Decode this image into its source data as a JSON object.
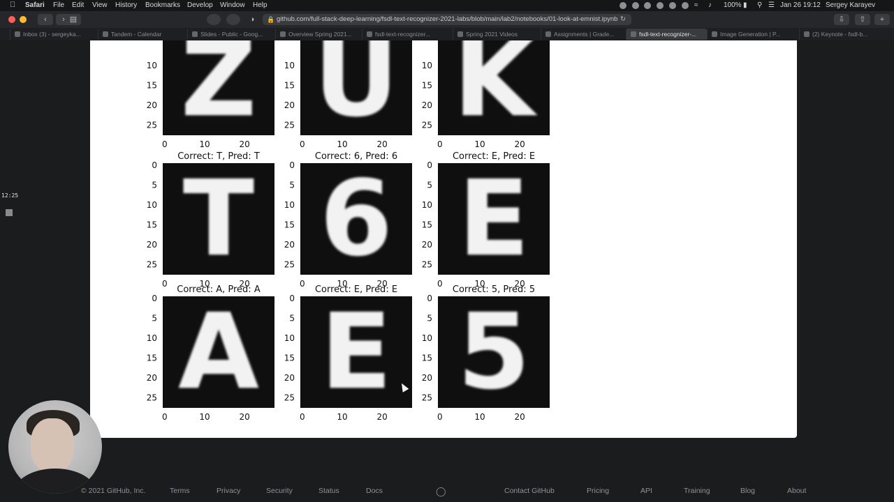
{
  "menubar": {
    "app_name": "Safari",
    "items": [
      "File",
      "Edit",
      "View",
      "History",
      "Bookmarks",
      "Develop",
      "Window",
      "Help"
    ],
    "battery": "100%",
    "datetime": "Jan 26  19:12",
    "user": "Sergey Karayev"
  },
  "toolbar": {
    "url": "github.com/full-stack-deep-learning/fsdl-text-recognizer-2021-labs/blob/main/lab2/notebooks/01-look-at-emnist.ipynb"
  },
  "tabs": [
    {
      "label": "Inbox (3) - sergeyka..."
    },
    {
      "label": "Tandem - Calendar"
    },
    {
      "label": "Slides - Public - Goog..."
    },
    {
      "label": "Overview Spring 2021..."
    },
    {
      "label": "fsdl-text-recognizer..."
    },
    {
      "label": "Spring 2021 Videos"
    },
    {
      "label": "Assignments | Grade..."
    },
    {
      "label": "fsdl-text-recognizer-...",
      "active": true
    },
    {
      "label": "Image Generation | P..."
    },
    {
      "label": "(2) Keynote - fsdl-b..."
    }
  ],
  "side_widget": {
    "time": "12:25"
  },
  "figure": {
    "panels": [
      {
        "title": "",
        "char": "Z"
      },
      {
        "title": "",
        "char": "U"
      },
      {
        "title": "",
        "char": "K"
      },
      {
        "title": "Correct: T, Pred: T",
        "char": "T"
      },
      {
        "title": "Correct: 6, Pred: 6",
        "char": "6"
      },
      {
        "title": "Correct: E, Pred: E",
        "char": "E"
      },
      {
        "title": "Correct: A, Pred: A",
        "char": "A"
      },
      {
        "title": "Correct: E, Pred: E",
        "char": "E"
      },
      {
        "title": "Correct: 5, Pred: 5",
        "char": "5"
      }
    ],
    "y_ticks_full": [
      "0",
      "5",
      "10",
      "15",
      "20",
      "25"
    ],
    "x_ticks": [
      "0",
      "10",
      "20"
    ]
  },
  "footer": {
    "copyright": "© 2021 GitHub, Inc.",
    "links_left": [
      "Terms",
      "Privacy",
      "Security",
      "Status",
      "Docs"
    ],
    "links_right": [
      "Contact GitHub",
      "Pricing",
      "API",
      "Training",
      "Blog",
      "About"
    ]
  }
}
